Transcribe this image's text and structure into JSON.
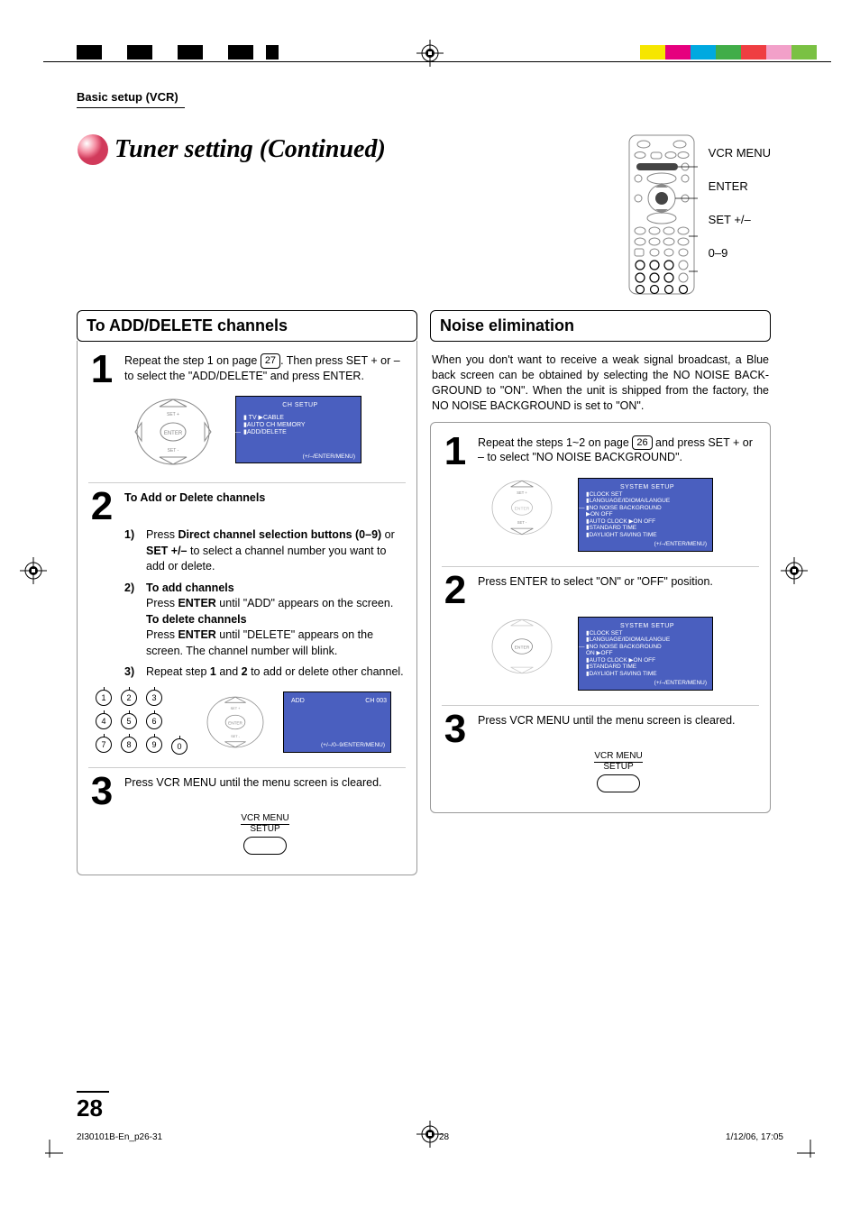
{
  "header": {
    "section_label": "Basic setup (VCR)",
    "title": "Tuner setting (Continued)"
  },
  "remote_labels": [
    "VCR MENU",
    "ENTER",
    "SET +/–",
    "0–9"
  ],
  "left": {
    "heading": "To ADD/DELETE channels",
    "step1": {
      "num": "1",
      "pre": "Repeat the step 1 on page ",
      "page": "27",
      "post": ". Then press SET + or – to select the \"ADD/DELETE\" and press ENTER."
    },
    "osd1": {
      "header": "CH SETUP",
      "lines": [
        "▮  TV  ▶CABLE",
        "▮AUTO CH MEMORY",
        "▮ADD/DELETE"
      ],
      "footer": "(+/–/ENTER/MENU)"
    },
    "step2": {
      "num": "2",
      "title": "To Add or Delete channels",
      "sub1_n": "1)",
      "sub1_pre": "Press ",
      "sub1_b": "Direct channel selection buttons (0–9)",
      "sub1_mid": " or ",
      "sub1_b2": "SET +/–",
      "sub1_post": " to select a channel number you want to add or delete.",
      "sub2_n": "2)",
      "sub2_b": "To add channels",
      "sub2_l1_pre": "Press ",
      "sub2_l1_b": "ENTER",
      "sub2_l1_post": " until \"ADD\" appears on the screen.",
      "sub2_b2": "To delete channels",
      "sub2_l2_pre": "Press ",
      "sub2_l2_b": "ENTER",
      "sub2_l2_post": " until \"DELETE\" appears on the screen. The channel number will blink.",
      "sub3_n": "3)",
      "sub3_pre": "Repeat step ",
      "sub3_b1": "1",
      "sub3_mid": " and ",
      "sub3_b2": "2",
      "sub3_post": " to add or delete other channel."
    },
    "osd2": {
      "add": "ADD",
      "ch": "CH  003",
      "footer": "(+/–/0–9/ENTER/MENU)"
    },
    "step3": {
      "num": "3",
      "text": "Press VCR MENU until the menu screen is cleared.",
      "fig_top": "VCR MENU",
      "fig_bot": "SETUP"
    }
  },
  "right": {
    "heading": "Noise elimination",
    "intro": "When you don't want to receive a weak signal broadcast, a Blue back screen can be obtained by selecting the NO NOISE BACK-GROUND to \"ON\". When the unit is shipped from the factory, the NO NOISE BACKGROUND is set to \"ON\".",
    "step1": {
      "num": "1",
      "pre": "Repeat the steps 1~2 on page ",
      "page": "26",
      "post": " and press SET + or – to select \"NO NOISE BACKGROUND\"."
    },
    "osd1": {
      "header": "SYSTEM SETUP",
      "lines": [
        "▮CLOCK SET",
        "▮LANGUAGE/IDIOMA/LANGUE",
        "▮NO NOISE BACKGROUND",
        "                    ▶ON   OFF",
        "▮AUTO CLOCK   ▶ON   OFF",
        "▮STANDARD TIME",
        "▮DAYLIGHT SAVING TIME"
      ],
      "footer": "(+/–/ENTER/MENU)"
    },
    "step2": {
      "num": "2",
      "text": "Press ENTER to select \"ON\" or \"OFF\" position."
    },
    "osd2": {
      "header": "SYSTEM SETUP",
      "lines": [
        "▮CLOCK SET",
        "▮LANGUAGE/IDIOMA/LANGUE",
        "▮NO NOISE BACKGROUND",
        "                     ON  ▶OFF",
        "▮AUTO CLOCK   ▶ON   OFF",
        "▮STANDARD TIME",
        "▮DAYLIGHT SAVING TIME"
      ],
      "footer": "(+/–/ENTER/MENU)"
    },
    "step3": {
      "num": "3",
      "text": "Press VCR MENU until the menu screen is cleared.",
      "fig_top": "VCR MENU",
      "fig_bot": "SETUP"
    }
  },
  "footer": {
    "page_number": "28",
    "file": "2I30101B-En_p26-31",
    "pg": "28",
    "date": "1/12/06, 17:05"
  },
  "colors": {
    "reg": [
      "#f6e600",
      "#e6007e",
      "#00a9e0",
      "#41ad49",
      "#ef3e42",
      "#f2a0c9",
      "#7ac143"
    ]
  }
}
